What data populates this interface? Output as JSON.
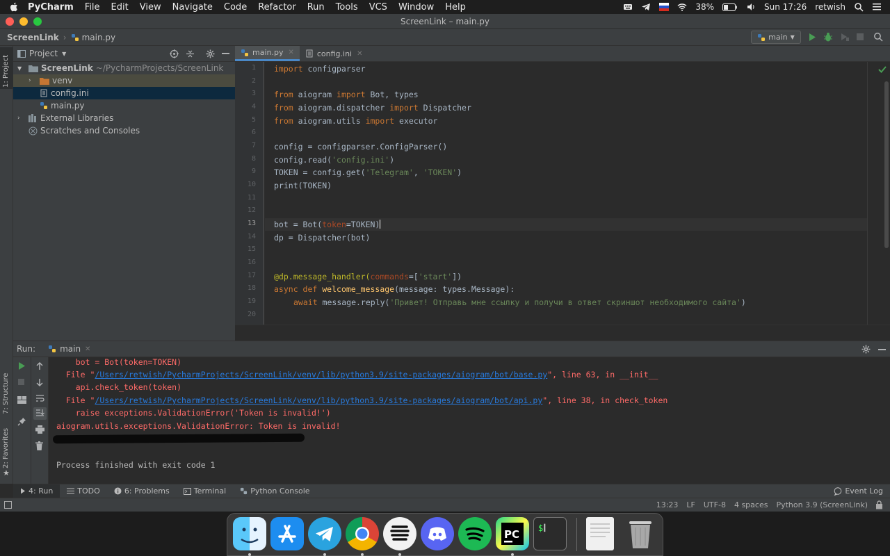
{
  "menubar": {
    "app_name": "PyCharm",
    "items": [
      "File",
      "Edit",
      "View",
      "Navigate",
      "Code",
      "Refactor",
      "Run",
      "Tools",
      "VCS",
      "Window",
      "Help"
    ],
    "battery": "38%",
    "clock": "Sun 17:26",
    "user": "retwish"
  },
  "window": {
    "title": "ScreenLink – main.py"
  },
  "navbar": {
    "project": "ScreenLink",
    "file": "main.py",
    "run_config": "main"
  },
  "project_panel": {
    "header": "Project",
    "root_name": "ScreenLink",
    "root_path": "~/PycharmProjects/ScreenLink",
    "items": [
      "venv",
      "config.ini",
      "main.py"
    ],
    "external": "External Libraries",
    "scratches": "Scratches and Consoles"
  },
  "side_labels": {
    "project": "1: Project",
    "structure": "7: Structure",
    "favorites": "2: Favorites"
  },
  "tabs": [
    {
      "label": "main.py"
    },
    {
      "label": "config.ini"
    }
  ],
  "editor": {
    "line_numbers": [
      "1",
      "2",
      "3",
      "4",
      "5",
      "6",
      "7",
      "8",
      "9",
      "10",
      "11",
      "12",
      "13",
      "14",
      "15",
      "16",
      "17",
      "18",
      "19",
      "20"
    ],
    "current_line": "13",
    "code": {
      "l1a": "import",
      "l1b": " configparser",
      "l3a": "from",
      "l3b": " aiogram ",
      "l3c": "import",
      "l3d": " Bot, types",
      "l4a": "from",
      "l4b": " aiogram.dispatcher ",
      "l4c": "import",
      "l4d": " Dispatcher",
      "l5a": "from",
      "l5b": " aiogram.utils ",
      "l5c": "import",
      "l5d": " executor",
      "l7": "config = configparser.ConfigParser()",
      "l8a": "config.read(",
      "l8b": "'config.ini'",
      "l8c": ")",
      "l9a": "TOKEN = config.get(",
      "l9b": "'Telegram'",
      "l9c": ", ",
      "l9d": "'TOKEN'",
      "l9e": ")",
      "l10": "print(TOKEN)",
      "l13a": "bot = Bot(",
      "l13b": "token",
      "l13c": "=TOKEN)",
      "l14": "dp = Dispatcher(bot)",
      "l17a": "@dp.message_handler(",
      "l17b": "commands",
      "l17c": "=[",
      "l17d": "'start'",
      "l17e": "])",
      "l18a": "async def",
      "l18b": " ",
      "l18c": "welcome_message",
      "l18d": "(message: types.Message):",
      "l19a": "await",
      "l19b": " message.reply(",
      "l19c": "'Привет! Отправь мне ссылку и получи в ответ скриншот необходимого сайта'",
      "l19d": ")"
    }
  },
  "run_panel": {
    "label": "Run:",
    "tab": "main",
    "lines": {
      "c1": "    bot = Bot(token=TOKEN)",
      "c2a": "  File \"",
      "c2b": "/Users/retwish/PycharmProjects/ScreenLink/venv/lib/python3.9/site-packages/aiogram/bot/base.py",
      "c2c": "\", line 63, in __init__",
      "c3": "    api.check_token(token)",
      "c4a": "  File \"",
      "c4b": "/Users/retwish/PycharmProjects/ScreenLink/venv/lib/python3.9/site-packages/aiogram/bot/api.py",
      "c4c": "\", line 38, in check_token",
      "c5": "    raise exceptions.ValidationError('Token is invalid!')",
      "c6": "aiogram.utils.exceptions.ValidationError: Token is invalid!",
      "c8": "Process finished with exit code 1"
    }
  },
  "bottom_tabs": {
    "run": "4: Run",
    "todo": "TODO",
    "problems": "6: Problems",
    "terminal": "Terminal",
    "python_console": "Python Console",
    "event_log": "Event Log"
  },
  "status": {
    "position": "13:23",
    "line_sep": "LF",
    "encoding": "UTF-8",
    "indent": "4 spaces",
    "interpreter": "Python 3.9 (ScreenLink)"
  },
  "colors": {
    "accent": "#4a88c7",
    "error": "#ff6b68",
    "run_green": "#499c54",
    "folder_orange": "#c57633"
  }
}
